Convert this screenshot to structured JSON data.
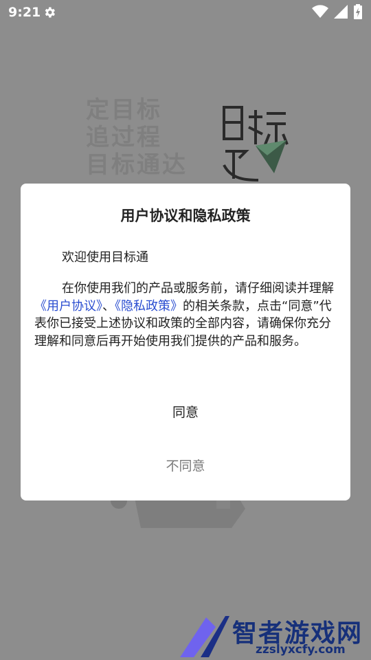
{
  "status_bar": {
    "time": "9:21",
    "icons": [
      "gear-icon",
      "wifi-icon",
      "signal-icon",
      "battery-icon"
    ]
  },
  "splash": {
    "slogan_lines": [
      "定目标",
      "追过程",
      "目标通达"
    ]
  },
  "dialog": {
    "title": "用户协议和隐私政策",
    "welcome": "欢迎使用目标通",
    "body_before": "在你使用我们的产品或服务前，请仔细阅读并理解",
    "user_agreement_link": "《用户协议》",
    "separator": "、",
    "privacy_link": "《隐私政策》",
    "body_after": "的相关条款，点击“同意”代表你已接受上述协议和政策的全部内容，请确保你充分理解和同意后再开始使用我们提供的产品和服务。",
    "agree_label": "同意",
    "disagree_label": "不同意"
  },
  "watermark": {
    "text": "智者游戏网",
    "sub": "zzslyxcfy.com"
  },
  "colors": {
    "overlay": "#8d8d8d",
    "link": "#2a4dd0",
    "watermark": "#16307a"
  }
}
